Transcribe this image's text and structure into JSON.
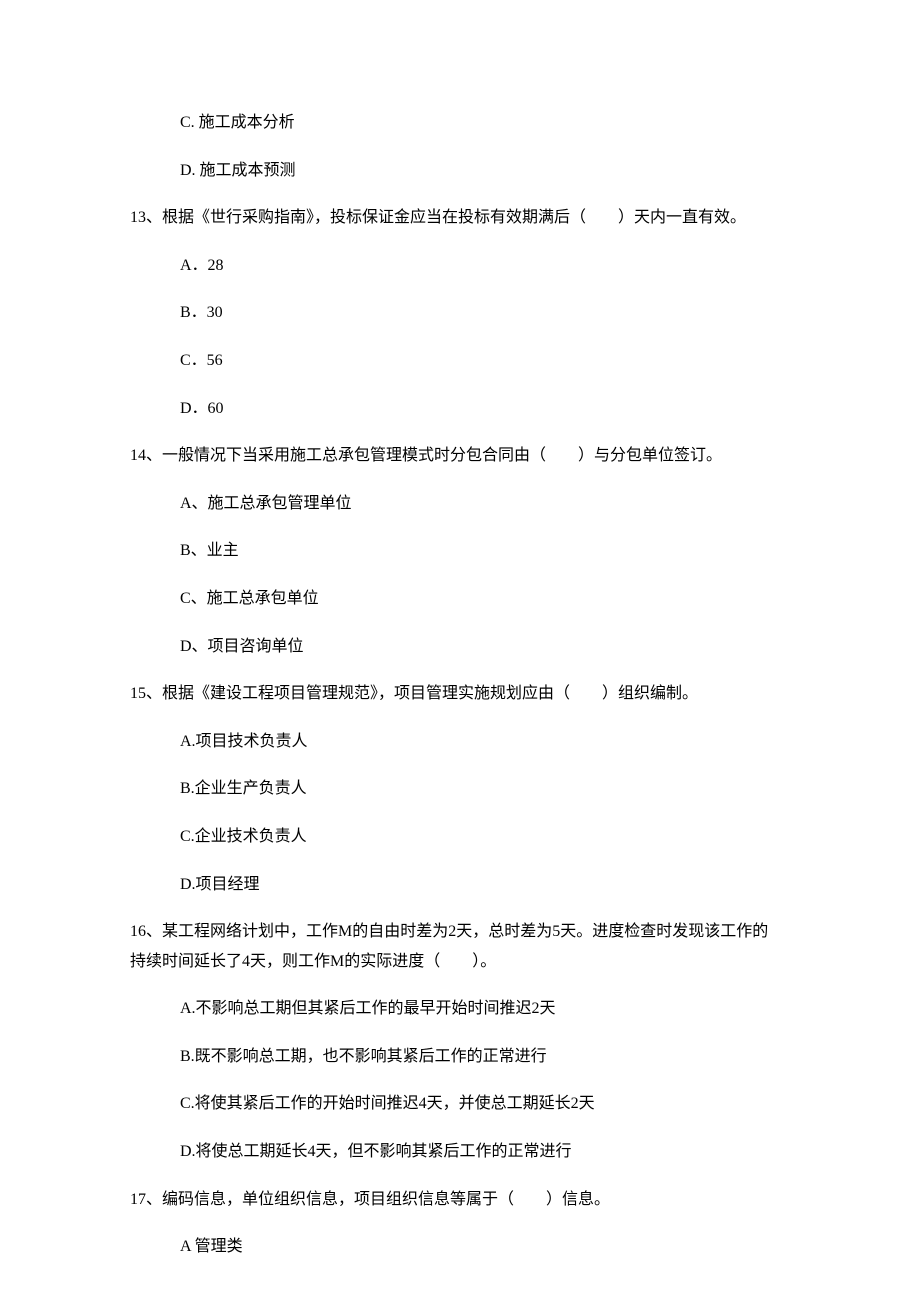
{
  "q12": {
    "options": {
      "C": "C. 施工成本分析",
      "D": "D. 施工成本预测"
    }
  },
  "q13": {
    "stem": "13、根据《世行采购指南》，投标保证金应当在投标有效期满后（　　）天内一直有效。",
    "options": {
      "A": "A．28",
      "B": "B．30",
      "C": "C．56",
      "D": "D．60"
    }
  },
  "q14": {
    "stem": "14、一般情况下当采用施工总承包管理模式时分包合同由（　　）与分包单位签订。",
    "options": {
      "A": "A、施工总承包管理单位",
      "B": "B、业主",
      "C": "C、施工总承包单位",
      "D": "D、项目咨询单位"
    }
  },
  "q15": {
    "stem": "15、根据《建设工程项目管理规范》，项目管理实施规划应由（　　）组织编制。",
    "options": {
      "A": "A.项目技术负责人",
      "B": "B.企业生产负责人",
      "C": "C.企业技术负责人",
      "D": "D.项目经理"
    }
  },
  "q16": {
    "stem_line1": "16、某工程网络计划中，工作M的自由时差为2天，总时差为5天。进度检查时发现该工作的",
    "stem_line2": "持续时间延长了4天，则工作M的实际进度（　　）。",
    "options": {
      "A": "A.不影响总工期但其紧后工作的最早开始时间推迟2天",
      "B": "B.既不影响总工期，也不影响其紧后工作的正常进行",
      "C": "C.将使其紧后工作的开始时间推迟4天，并使总工期延长2天",
      "D": "D.将使总工期延长4天，但不影响其紧后工作的正常进行"
    }
  },
  "q17": {
    "stem": "17、编码信息，单位组织信息，项目组织信息等属于（　　）信息。",
    "options": {
      "A": "A 管理类"
    }
  }
}
